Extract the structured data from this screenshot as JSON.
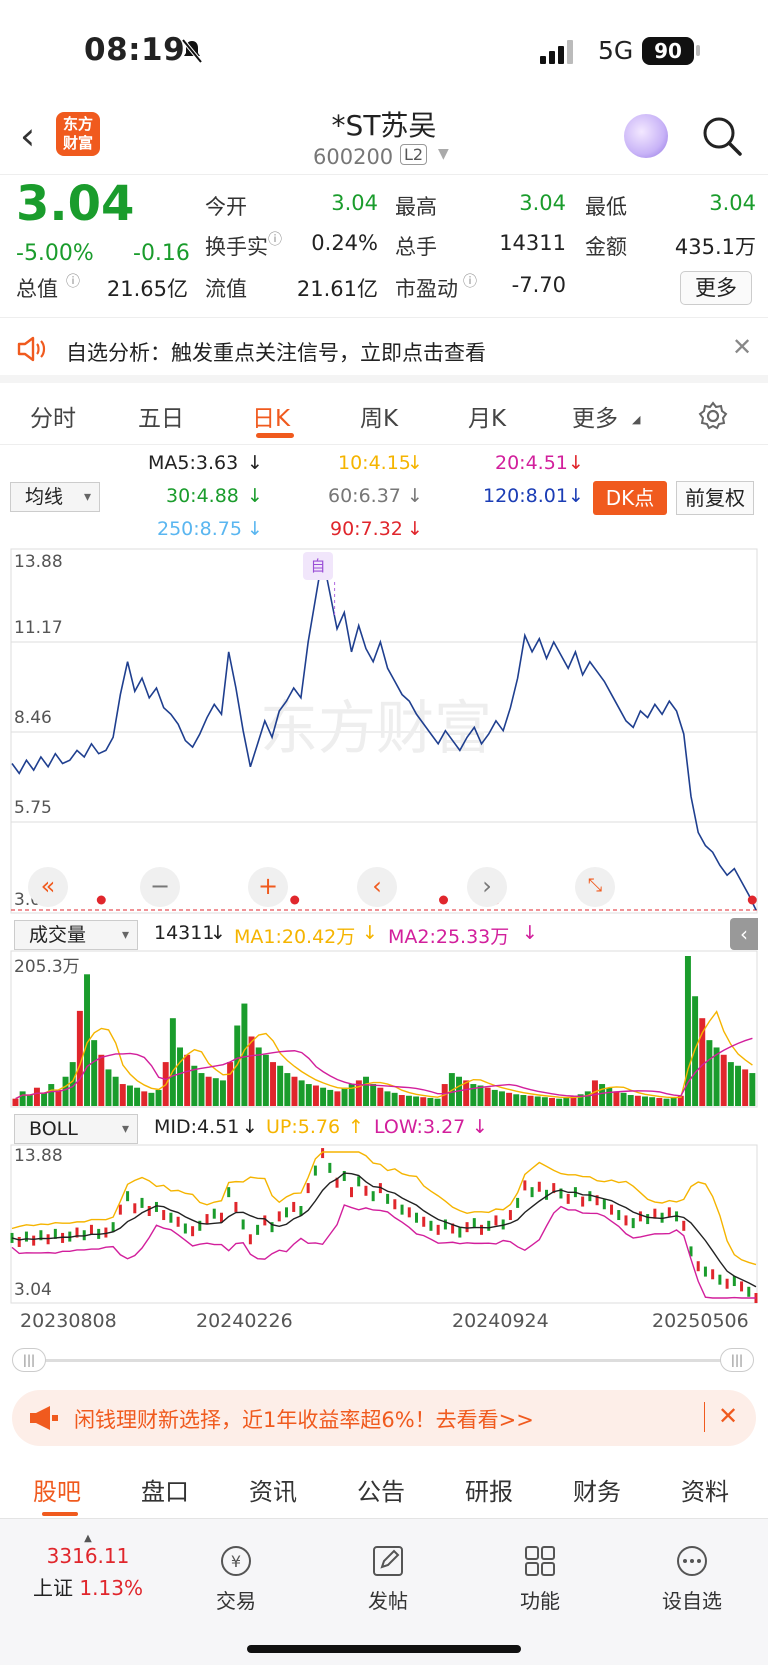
{
  "status": {
    "time": "08:19",
    "network": "5G",
    "battery": "90"
  },
  "header": {
    "logo": "东方财富",
    "stock_name": "*ST苏吴",
    "stock_code": "600200",
    "level": "L2"
  },
  "quote": {
    "price": "3.04",
    "pct": "-5.00%",
    "change": "-0.16",
    "fields": [
      {
        "label": "今开",
        "value": "3.04"
      },
      {
        "label": "最高",
        "value": "3.04"
      },
      {
        "label": "最低",
        "value": "3.04"
      },
      {
        "label": "换手实",
        "value": "0.24%"
      },
      {
        "label": "总手",
        "value": "14311"
      },
      {
        "label": "金额",
        "value": "435.1万"
      },
      {
        "label": "总值",
        "value": "21.65亿"
      },
      {
        "label": "流值",
        "value": "21.61亿"
      },
      {
        "label": "市盈动",
        "value": "-7.70"
      }
    ],
    "more": "更多",
    "colors": {
      "down": "#1a9c2c",
      "up": "#e0262c",
      "accent": "#f05a1e"
    }
  },
  "notice": {
    "text": "自选分析：触发重点关注信号，立即点击查看"
  },
  "tabs": {
    "items": [
      "分时",
      "五日",
      "日K",
      "周K",
      "月K",
      "更多"
    ],
    "active": "日K"
  },
  "indicators": {
    "select": "均线",
    "ma": [
      "MA5:3.63",
      "10:4.15",
      "20:4.51",
      "30:4.88",
      "60:6.37",
      "120:8.01",
      "250:8.75",
      "90:7.32"
    ],
    "dk": "DK点",
    "adjust": "前复权"
  },
  "chart_data": [
    {
      "type": "line",
      "y_ticks": [
        "13.88",
        "11.17",
        "8.46",
        "5.75",
        "3.04"
      ],
      "ylim": [
        3.04,
        13.88
      ],
      "marker": "自",
      "values": [
        7.5,
        7.2,
        7.6,
        7.3,
        7.7,
        7.4,
        7.8,
        7.5,
        7.6,
        7.9,
        7.7,
        8.1,
        7.8,
        7.9,
        8.3,
        9.6,
        10.6,
        9.7,
        10.1,
        9.5,
        9.8,
        9.2,
        9.0,
        8.7,
        8.2,
        8.0,
        8.4,
        8.9,
        9.3,
        9.0,
        10.9,
        9.8,
        8.5,
        7.4,
        8.1,
        8.8,
        8.3,
        9.1,
        9.4,
        9.8,
        9.5,
        11.2,
        12.5,
        13.8,
        12.7,
        11.6,
        12.1,
        10.9,
        11.7,
        11.0,
        10.6,
        11.2,
        10.4,
        10.0,
        9.6,
        9.4,
        9.0,
        8.7,
        8.4,
        8.1,
        8.5,
        8.2,
        7.9,
        8.3,
        8.6,
        8.1,
        8.4,
        8.8,
        8.5,
        9.2,
        10.1,
        11.4,
        10.9,
        11.3,
        10.7,
        11.2,
        10.8,
        10.4,
        10.9,
        10.2,
        10.6,
        10.3,
        10.0,
        9.6,
        9.2,
        8.8,
        8.6,
        9.1,
        8.9,
        9.3,
        9.0,
        9.4,
        9.1,
        8.4,
        6.5,
        5.4,
        5.0,
        4.8,
        4.4,
        4.1,
        4.3,
        3.9,
        3.5,
        3.04
      ]
    },
    {
      "type": "bar",
      "ylabel_max": "205.3万",
      "values": [
        10,
        20,
        15,
        25,
        18,
        30,
        22,
        40,
        60,
        130,
        180,
        90,
        70,
        50,
        40,
        30,
        28,
        25,
        20,
        18,
        22,
        60,
        120,
        80,
        70,
        55,
        45,
        40,
        38,
        35,
        60,
        110,
        140,
        95,
        80,
        70,
        60,
        55,
        45,
        40,
        35,
        30,
        28,
        25,
        22,
        20,
        25,
        30,
        35,
        40,
        30,
        25,
        20,
        18,
        15,
        14,
        13,
        12,
        11,
        10,
        30,
        45,
        40,
        35,
        30,
        28,
        25,
        22,
        20,
        18,
        16,
        15,
        14,
        13,
        12,
        11,
        10,
        12,
        14,
        16,
        20,
        35,
        30,
        25,
        20,
        18,
        15,
        14,
        13,
        12,
        11,
        10,
        12,
        14,
        205,
        150,
        120,
        90,
        80,
        70,
        60,
        55,
        50,
        45
      ]
    },
    {
      "type": "line",
      "y_ticks": [
        "13.88",
        "3.04"
      ],
      "ylim": [
        3.04,
        13.88
      ]
    }
  ],
  "volume": {
    "select": "成交量",
    "vol": "14311",
    "ma1": "MA1:20.42万",
    "ma2": "MA2:25.33万"
  },
  "boll": {
    "select": "BOLL",
    "mid": "MID:4.51",
    "up": "UP:5.76",
    "low": "LOW:3.27"
  },
  "dates": [
    "20230808",
    "20240226",
    "20240924",
    "20250506"
  ],
  "promo": {
    "text": "闲钱理财新选择，近1年收益率超6%！去看看>>"
  },
  "bottom_tabs": {
    "items": [
      "股吧",
      "盘口",
      "资讯",
      "公告",
      "研报",
      "财务",
      "资料"
    ],
    "active": "股吧"
  },
  "dock": {
    "index_value": "3316.11",
    "index_name": "上证",
    "index_pct": "1.13%",
    "items": [
      "交易",
      "发帖",
      "功能",
      "设自选"
    ]
  }
}
